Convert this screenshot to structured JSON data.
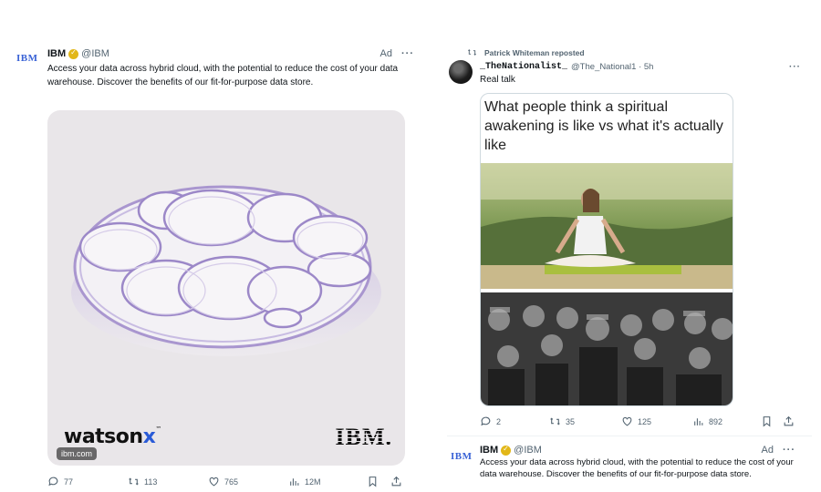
{
  "left_tweet": {
    "avatar_text": "IBM",
    "name": "IBM",
    "handle": "@IBM",
    "ad_label": "Ad",
    "more": "···",
    "text": "Access your data across hybrid cloud, with the potential to reduce the cost of your data warehouse. Discover the benefits of our fit-for-purpose data store.",
    "media": {
      "product_name": "watson",
      "product_suffix": "x",
      "trademark": "™",
      "brand_logo": "IBM.",
      "url_pill": "ibm.com"
    },
    "actions": {
      "replies": "77",
      "reposts": "113",
      "likes": "765",
      "views": "12M"
    }
  },
  "right_tweet": {
    "repost_by": "Patrick Whiteman reposted",
    "name": "_TheNationalist_",
    "handle": "@The_National1 · 5h",
    "more": "···",
    "text": "Real talk",
    "meme_caption": "What people think a spiritual awakening is like vs what it's actually like",
    "actions": {
      "replies": "2",
      "reposts": "35",
      "likes": "125",
      "views": "892"
    }
  },
  "bottom_tweet": {
    "avatar_text": "IBM",
    "name": "IBM",
    "handle": "@IBM",
    "ad_label": "Ad",
    "more": "···",
    "text": "Access your data across hybrid cloud, with the potential to reduce the cost of your data warehouse. Discover the benefits of our fit-for-purpose data store."
  },
  "colors": {
    "verified": "#e2b719",
    "ibm_blue": "#3a63d6",
    "muted": "#536471"
  }
}
